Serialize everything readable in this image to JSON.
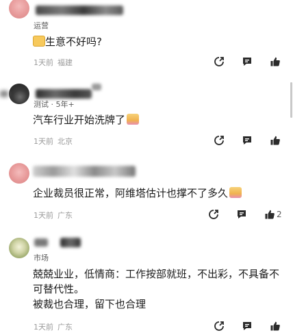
{
  "comments": [
    {
      "name": "",
      "tag": "运营",
      "text": "生意不好吗?",
      "time": "1天前",
      "location": "福建",
      "likes": ""
    },
    {
      "name": "",
      "tag": "测试 · 5年+",
      "text": "汽车行业开始洗牌了",
      "time": "1天前",
      "location": "北京",
      "likes": ""
    },
    {
      "name": "",
      "tag": "",
      "text": "企业裁员很正常，阿维塔估计也撑不了多久",
      "time": "1天前",
      "location": "广东",
      "likes": "2"
    },
    {
      "name": "",
      "tag": "市场",
      "text_lines": [
        "兢兢业业，低情商：工作按部就班，不出彩，不具备不可替代性。",
        "被裁也合理，留下也合理"
      ],
      "time": "1天前",
      "location": "广东",
      "likes": ""
    }
  ],
  "icons": {
    "share": "share-icon",
    "reply": "comment-icon",
    "like": "thumbs-up-icon",
    "emoji": "emoji-sticker-icon"
  },
  "colors": {
    "text": "#1a1a1a",
    "meta": "#9a9a9a",
    "icon": "#2b2b2b"
  }
}
